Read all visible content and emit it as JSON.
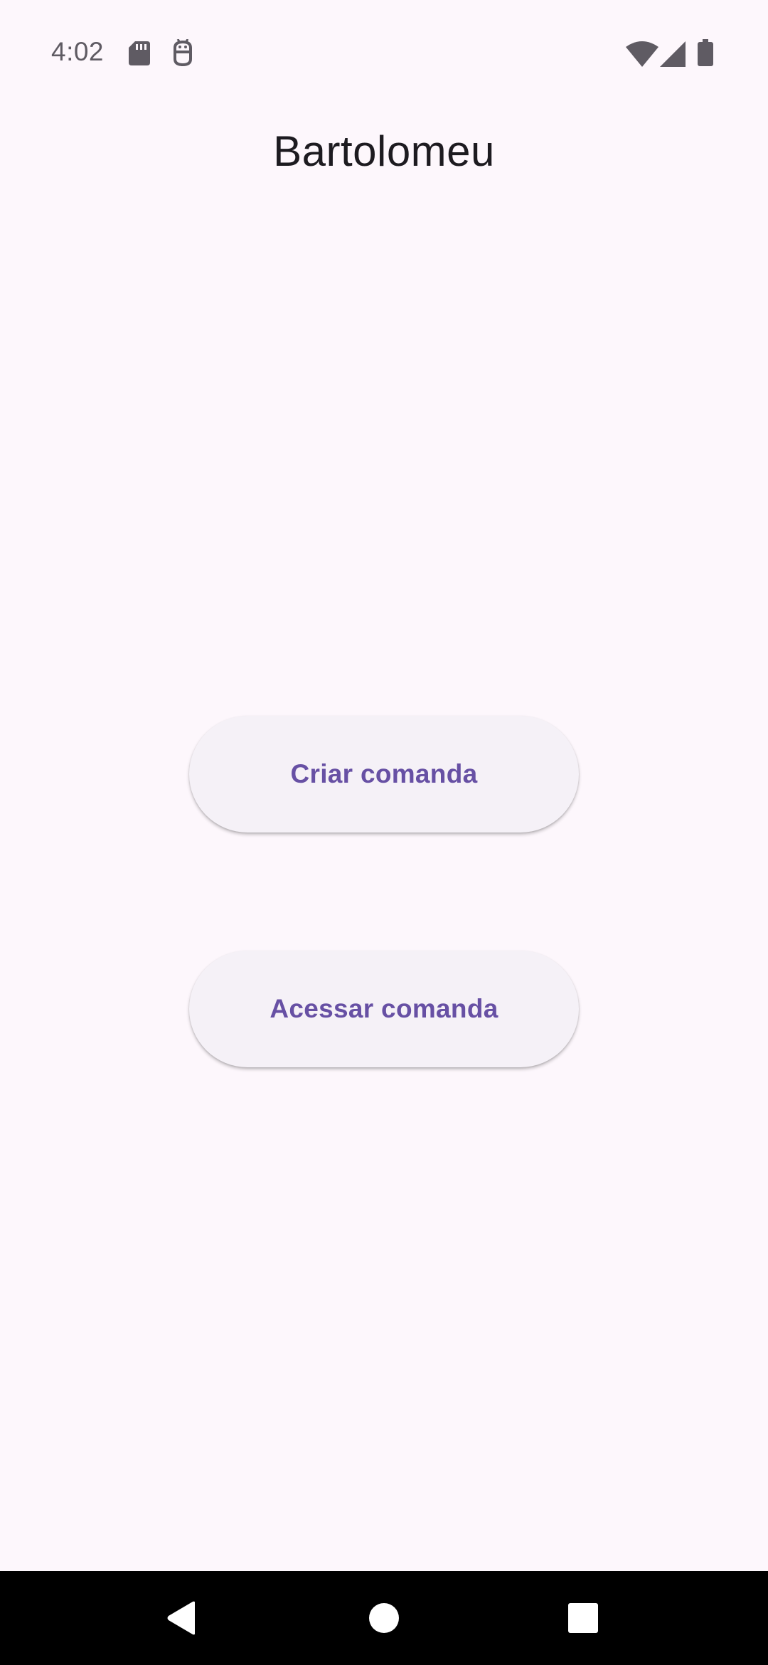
{
  "status_bar": {
    "time": "4:02",
    "icons": [
      "sd-card-icon",
      "android-bot-icon",
      "wifi-icon",
      "cell-signal-icon",
      "battery-icon"
    ]
  },
  "app": {
    "title": "Bartolomeu"
  },
  "actions": {
    "create_label": "Criar comanda",
    "access_label": "Acessar comanda"
  },
  "navigation": {
    "back": "back-icon",
    "home": "home-icon",
    "recents": "recents-icon"
  },
  "colors": {
    "background": "#fdf7fc",
    "button_surface": "#f5f1f7",
    "accent": "#6750a4",
    "title_text": "#1d1b20",
    "status_text": "#5f5b63",
    "nav_bar": "#000000"
  }
}
